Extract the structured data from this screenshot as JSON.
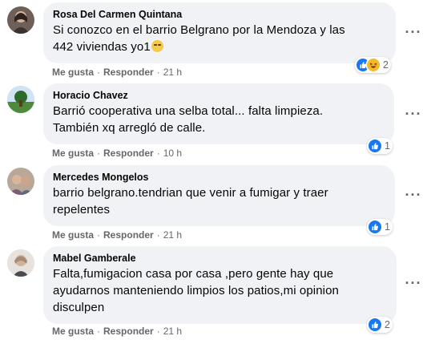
{
  "comments": [
    {
      "author": "Rosa Del Carmen Quintana",
      "lines": [
        "Si conozco en el barrio Belgrano por la Mendoza y las",
        "442 viviendas yo1"
      ],
      "reaction_count": "2",
      "like": "Me gusta",
      "reply": "Responder",
      "time": "21 h"
    },
    {
      "author": "Horacio Chavez",
      "lines": [
        "Barrió cooperativa una selba total... falta limpieza.",
        "También xq arregló de calle."
      ],
      "reaction_count": "1",
      "like": "Me gusta",
      "reply": "Responder",
      "time": "10 h"
    },
    {
      "author": "Mercedes Mongelos",
      "lines": [
        "barrio belgrano.tendrian que venir a fumigar y traer",
        "repelentes"
      ],
      "reaction_count": "1",
      "like": "Me gusta",
      "reply": "Responder",
      "time": "21 h"
    },
    {
      "author": "Mabel Gamberale",
      "lines": [
        "Falta,fumigacion casa por casa ,pero gente hay que",
        "ayudarnos manteniendo limpios los patios,mi opinion",
        "disculpen"
      ],
      "reaction_count": "2",
      "like": "Me gusta",
      "reply": "Responder",
      "time": "21 h"
    }
  ],
  "separator": "·",
  "more_label": "···"
}
